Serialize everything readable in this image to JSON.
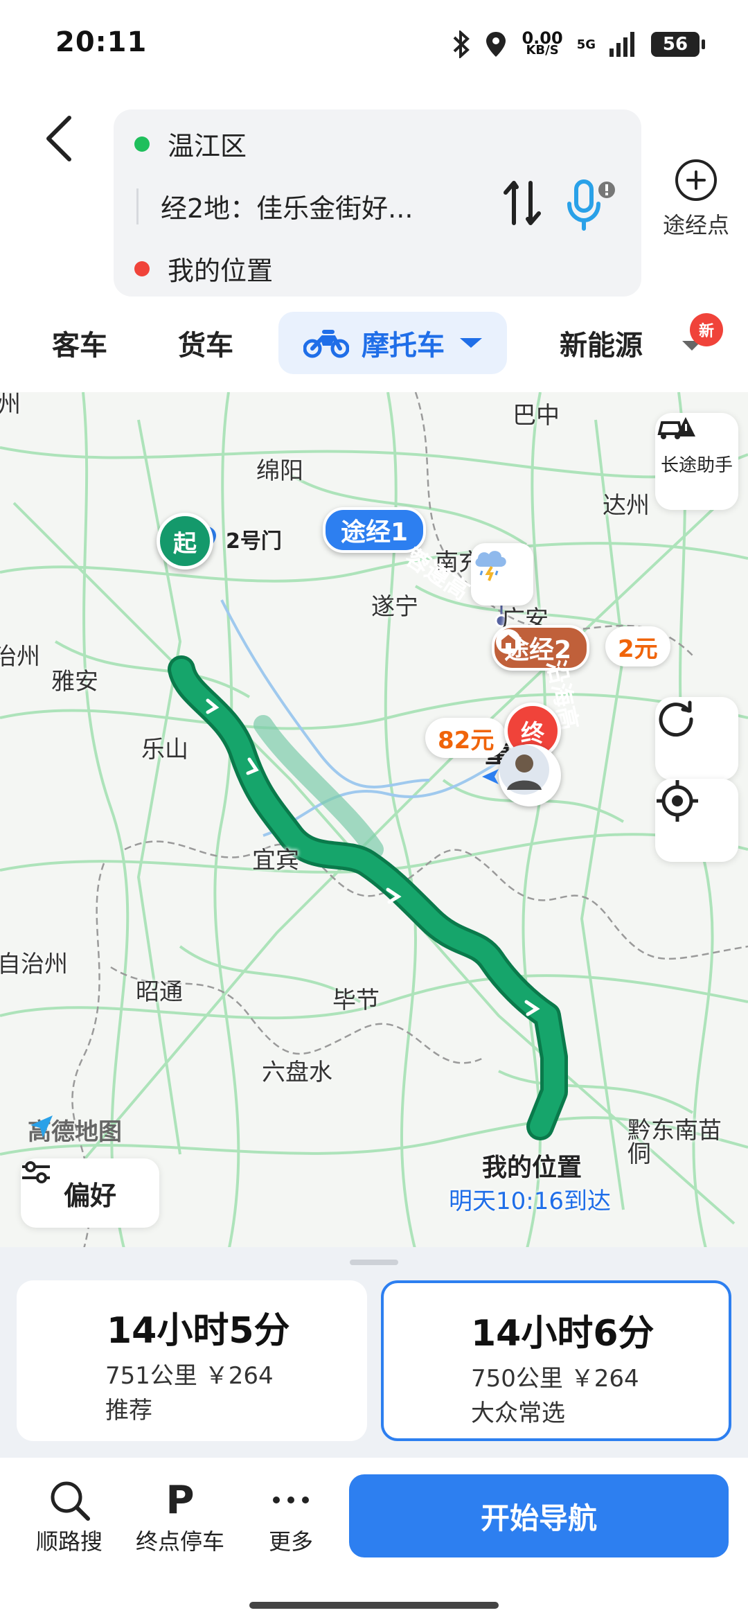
{
  "status": {
    "time": "20:11",
    "net_speed_value": "0.00",
    "net_speed_unit": "KB/S",
    "network": "5G",
    "battery": "56"
  },
  "route": {
    "origin": "温江区",
    "via": "经2地：佳乐金街好...",
    "destination": "我的位置",
    "origin_color": "#1fbf5c",
    "destination_color": "#f0433a",
    "add_stop_label": "途经点"
  },
  "tabs": [
    {
      "label": "客车"
    },
    {
      "label": "货车"
    },
    {
      "label": "摩托车"
    },
    {
      "label": "新能源"
    }
  ],
  "new_badge": "新",
  "map": {
    "cities": [
      "巴中",
      "绵阳",
      "达州",
      "南充",
      "遂宁",
      "广安",
      "雅安",
      "乐山",
      "重庆",
      "宜宾",
      "昭通",
      "毕节",
      "六盘水",
      "自治州",
      "治州",
      "州",
      "黔东南苗",
      "侗"
    ],
    "gate_label": "2号门",
    "start_pin": "起",
    "end_pin": "终",
    "via1": "途经1",
    "via2": "途经2",
    "road1": "蓉遵高",
    "road2": "沿海高",
    "price_left": "82元",
    "price_right": "2元",
    "long_trip_helper": "长途助手",
    "logo": "高德地图",
    "preference": "偏好",
    "my_location": "我的位置",
    "eta": "明天10:16到达",
    "route_color": "#16a56b"
  },
  "options": [
    {
      "time": "14小时5分",
      "detail": "751公里 ￥264",
      "tag": "推荐"
    },
    {
      "time": "14小时6分",
      "detail": "750公里 ￥264",
      "tag": "大众常选"
    }
  ],
  "bottom": {
    "search": "顺路搜",
    "parking_icon": "P",
    "parking": "终点停车",
    "more": "更多",
    "start": "开始导航"
  }
}
